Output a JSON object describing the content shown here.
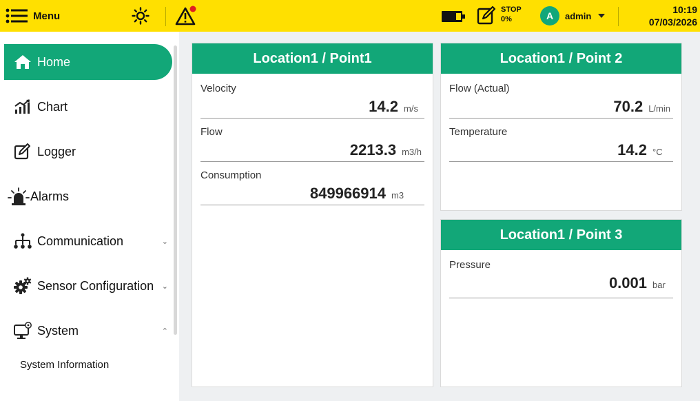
{
  "topbar": {
    "menu_label": "Menu",
    "recording_status": "STOP",
    "recording_percent": "0%",
    "user_initial": "A",
    "user_name": "admin",
    "time": "10:19",
    "date": "07/03/2026",
    "icons": [
      "menu-icon",
      "brightness-icon",
      "warning-icon",
      "battery-icon",
      "recording-icon",
      "chevron-down-icon"
    ],
    "colors": {
      "bar": "#ffe000",
      "accent": "#12a778",
      "alert_dot": "#e02020"
    }
  },
  "sidebar": {
    "items": [
      {
        "label": "Home",
        "icon": "home-icon",
        "active": true
      },
      {
        "label": "Chart",
        "icon": "chart-icon"
      },
      {
        "label": "Logger",
        "icon": "logger-icon"
      },
      {
        "label": "Alarms",
        "icon": "alarm-icon"
      },
      {
        "label": "Communication",
        "icon": "network-icon",
        "chevron": "⌄"
      },
      {
        "label": "Sensor Configuration",
        "icon": "gear-icon",
        "chevron": "⌄"
      },
      {
        "label": "System",
        "icon": "monitor-icon",
        "chevron": "⌃"
      }
    ],
    "sub_items": [
      "System Information"
    ]
  },
  "cards": [
    {
      "title": "Location1 / Point1",
      "rows": [
        {
          "name": "Velocity",
          "value": "14.2",
          "unit": "m/s"
        },
        {
          "name": "Flow",
          "value": "2213.3",
          "unit": "m3/h"
        },
        {
          "name": "Consumption",
          "value": "849966914",
          "unit": "m3"
        }
      ]
    },
    {
      "title": "Location1 / Point 2",
      "rows": [
        {
          "name": "Flow (Actual)",
          "value": "70.2",
          "unit": "L/min"
        },
        {
          "name": "Temperature",
          "value": "14.2",
          "unit": "°C"
        }
      ]
    },
    {
      "title": "Location1 / Point 3",
      "rows": [
        {
          "name": "Pressure",
          "value": "0.001",
          "unit": "bar"
        }
      ]
    }
  ]
}
